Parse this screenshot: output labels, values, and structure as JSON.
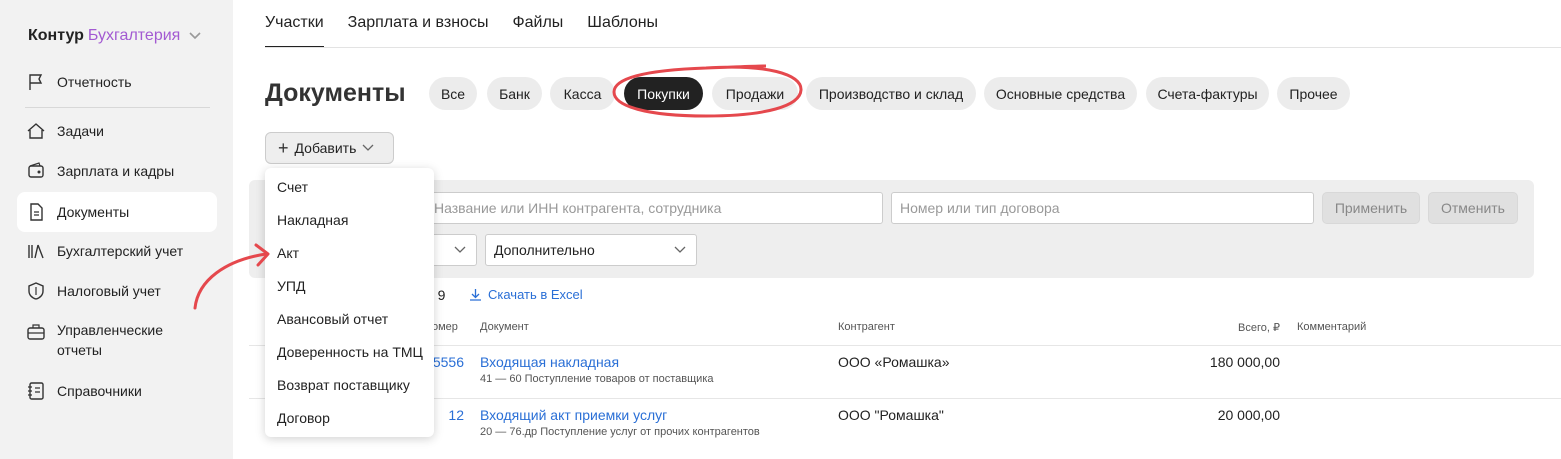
{
  "sidebar": {
    "brand_main": "Контур",
    "brand_product": "Бухгалтерия",
    "items": [
      {
        "label": "Отчетность"
      },
      {
        "label": "Задачи"
      },
      {
        "label": "Зарплата и кадры"
      },
      {
        "label": "Документы"
      },
      {
        "label": "Бухгалтерский учет"
      },
      {
        "label": "Налоговый учет"
      },
      {
        "label": "Управленческие отчеты"
      },
      {
        "label": "Справочники"
      }
    ]
  },
  "tabs": [
    "Участки",
    "Зарплата и взносы",
    "Файлы",
    "Шаблоны"
  ],
  "page": {
    "title": "Документы",
    "chips": [
      "Все",
      "Банк",
      "Касса",
      "Покупки",
      "Продажи",
      "Производство и склад",
      "Основные средства",
      "Счета-фактуры",
      "Прочее"
    ],
    "add_label": "Добавить"
  },
  "filters": {
    "search_placeholder": "Название или ИНН контрагента, сотрудника",
    "contract_placeholder": "Номер или тип договора",
    "apply": "Применить",
    "cancel": "Отменить",
    "extra": "Дополнительно"
  },
  "list": {
    "count_text": "а 9",
    "excel": "Скачать в Excel",
    "headers": {
      "num": "омер",
      "doc": "Документ",
      "cp": "Контрагент",
      "sum": "Всего, ₽",
      "comment": "Комментарий"
    },
    "rows": [
      {
        "num": "5556",
        "doc": "Входящая накладная",
        "sub": "41 — 60 Поступление товаров от поставщика",
        "cp": "ООО «Ромашка»",
        "sum": "180 000,00"
      },
      {
        "num": "12",
        "doc": "Входящий акт приемки услуг",
        "sub": "20 — 76.др Поступление услуг от прочих контрагентов",
        "cp": "ООО \"Ромашка\"",
        "sum": "20 000,00"
      }
    ]
  },
  "dropdown": [
    "Счет",
    "Накладная",
    "Акт",
    "УПД",
    "Авансовый отчет",
    "Доверенность на ТМЦ",
    "Возврат поставщику",
    "Договор"
  ],
  "colors": {
    "accent": "#a35ad2",
    "link": "#2a6fd6",
    "annotation": "#e5484d"
  }
}
